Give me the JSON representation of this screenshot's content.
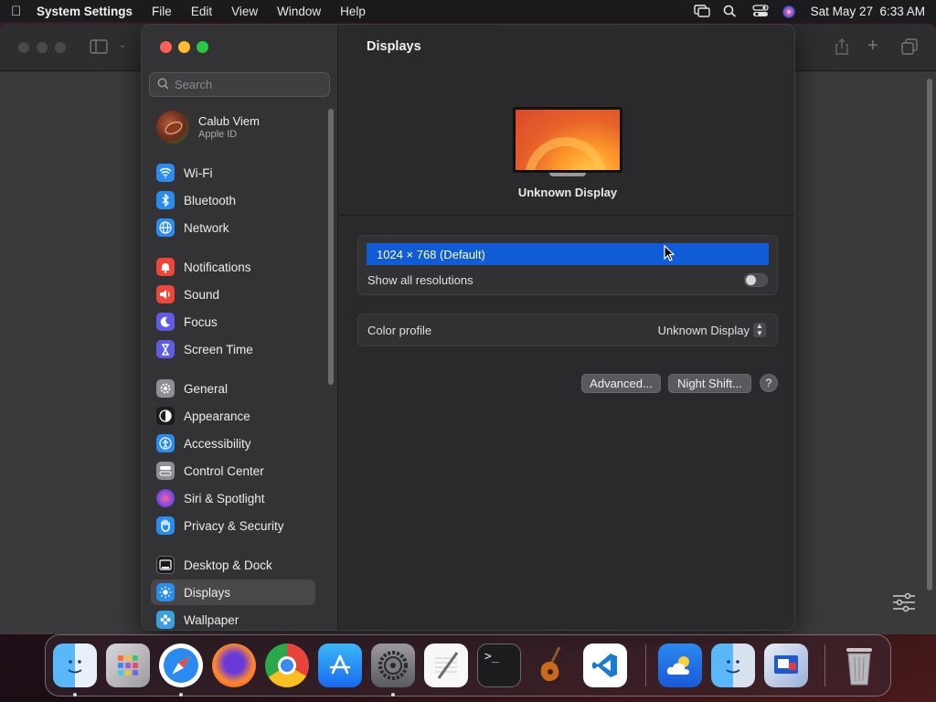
{
  "menubar": {
    "app": "System Settings",
    "items": [
      "File",
      "Edit",
      "View",
      "Window",
      "Help"
    ],
    "datetime": "Sat May 27  6:33 AM"
  },
  "search": {
    "placeholder": "Search"
  },
  "profile": {
    "name": "Calub Viem",
    "subtitle": "Apple ID"
  },
  "sidebar": {
    "items": [
      {
        "label": "Wi-Fi",
        "icon": "wifi-icon",
        "color": "#2b8cf0"
      },
      {
        "label": "Bluetooth",
        "icon": "bluetooth-icon",
        "color": "#2b8cf0"
      },
      {
        "label": "Network",
        "icon": "globe-icon",
        "color": "#2b8cf0"
      },
      {
        "label": "Notifications",
        "icon": "bell-icon",
        "color": "#f0453a"
      },
      {
        "label": "Sound",
        "icon": "speaker-icon",
        "color": "#f0453a"
      },
      {
        "label": "Focus",
        "icon": "moon-icon",
        "color": "#5e5ce6"
      },
      {
        "label": "Screen Time",
        "icon": "hourglass-icon",
        "color": "#5e5ce6"
      },
      {
        "label": "General",
        "icon": "gear-icon",
        "color": "#8e8e93"
      },
      {
        "label": "Appearance",
        "icon": "appearance-icon",
        "color": "#1c1c1e"
      },
      {
        "label": "Accessibility",
        "icon": "accessibility-icon",
        "color": "#2b8cf0"
      },
      {
        "label": "Control Center",
        "icon": "switches-icon",
        "color": "#8e8e93"
      },
      {
        "label": "Siri & Spotlight",
        "icon": "siri-icon",
        "color": "#9b59b6"
      },
      {
        "label": "Privacy & Security",
        "icon": "hand-icon",
        "color": "#2b8cf0"
      },
      {
        "label": "Desktop & Dock",
        "icon": "dock-icon",
        "color": "#1c1c1e"
      },
      {
        "label": "Displays",
        "icon": "sun-icon",
        "color": "#2b8cf0"
      },
      {
        "label": "Wallpaper",
        "icon": "flower-icon",
        "color": "#3aa0e0"
      }
    ]
  },
  "main": {
    "title": "Displays",
    "display_name": "Unknown Display",
    "resolution": "1024 × 768 (Default)",
    "show_all_resolutions": "Show all resolutions",
    "color_profile_label": "Color profile",
    "color_profile_value": "Unknown Display",
    "advanced_button": "Advanced...",
    "night_shift_button": "Night Shift...",
    "help_button": "?"
  },
  "dock": {
    "apps": [
      "finder",
      "launchpad",
      "safari",
      "firefox",
      "chrome",
      "app-store",
      "system-settings",
      "textedit",
      "terminal",
      "garageband",
      "vscode",
      "weather",
      "finder-alt",
      "remote-desktop",
      "trash"
    ]
  }
}
